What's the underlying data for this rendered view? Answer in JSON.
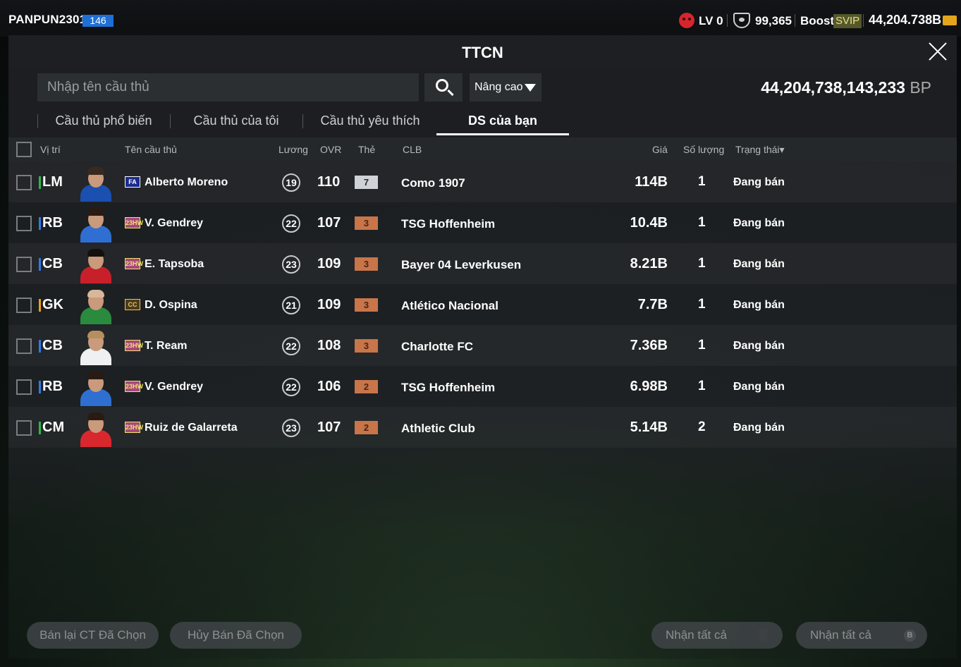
{
  "topbar": {
    "username": "PANPUN2301",
    "level": "146",
    "lv_text": "LV 0",
    "coins": "99,365",
    "boost": "Boost",
    "svip": "SVIP",
    "bp": "44,204.738B"
  },
  "panel": {
    "title": "TTCN",
    "search_placeholder": "Nhập tên cầu thủ",
    "advanced_label": "Nâng cao",
    "bp_total": "44,204,738,143,233",
    "bp_unit": "BP"
  },
  "tabs": [
    "Cầu thủ phổ biến",
    "Cầu thủ của tôi",
    "Cầu thủ yêu thích",
    "DS của bạn"
  ],
  "columns": {
    "position": "Vị trí",
    "name": "Tên cầu thủ",
    "wage": "Lương",
    "ovr": "OVR",
    "card": "Thẻ",
    "club": "CLB",
    "price": "Giá",
    "quantity": "Số lượng",
    "status": "Trạng thái▾"
  },
  "rows": [
    {
      "pos": "LM",
      "pos_color": "#2db84a",
      "season": "FA",
      "season_bg": "#1b2c8c",
      "season_fg": "#ffffff",
      "name": "Alberto Moreno",
      "wage": "19",
      "ovr": "110",
      "card": "7",
      "card_bg": "#cfd3d8",
      "card_fg": "#2b2e31",
      "club": "Como 1907",
      "price": "114B",
      "qty": "1",
      "status": "Đang bán",
      "kit": "#1b4fb0",
      "hair": "#3a2a1e"
    },
    {
      "pos": "RB",
      "pos_color": "#2f7be8",
      "season": "23HW",
      "season_bg": "#a8487e",
      "season_fg": "#f1e46a",
      "name": "V. Gendrey",
      "wage": "22",
      "ovr": "107",
      "card": "3",
      "card_bg": "#c8754a",
      "card_fg": "#4b2412",
      "club": "TSG Hoffenheim",
      "price": "10.4B",
      "qty": "1",
      "status": "Đang bán",
      "kit": "#2f6fd1",
      "hair": "#2a1b12"
    },
    {
      "pos": "CB",
      "pos_color": "#2f7be8",
      "season": "23HW",
      "season_bg": "#a8487e",
      "season_fg": "#f1e46a",
      "name": "E. Tapsoba",
      "wage": "23",
      "ovr": "109",
      "card": "3",
      "card_bg": "#c8754a",
      "card_fg": "#4b2412",
      "club": "Bayer 04 Leverkusen",
      "price": "8.21B",
      "qty": "1",
      "status": "Đang bán",
      "kit": "#c8202a",
      "hair": "#151010"
    },
    {
      "pos": "GK",
      "pos_color": "#e6a21e",
      "season": "CC",
      "season_bg": "#4a3b1a",
      "season_fg": "#f0c15a",
      "name": "D. Ospina",
      "wage": "21",
      "ovr": "109",
      "card": "3",
      "card_bg": "#c8754a",
      "card_fg": "#4b2412",
      "club": "Atlético Nacional",
      "price": "7.7B",
      "qty": "1",
      "status": "Đang bán",
      "kit": "#2a8a3e",
      "hair": "#d8b79a"
    },
    {
      "pos": "CB",
      "pos_color": "#2f7be8",
      "season": "23HW",
      "season_bg": "#a8487e",
      "season_fg": "#f1e46a",
      "name": "T. Ream",
      "wage": "22",
      "ovr": "108",
      "card": "3",
      "card_bg": "#c8754a",
      "card_fg": "#4b2412",
      "club": "Charlotte FC",
      "price": "7.36B",
      "qty": "1",
      "status": "Đang bán",
      "kit": "#eef0f2",
      "hair": "#b78f5e"
    },
    {
      "pos": "RB",
      "pos_color": "#2f7be8",
      "season": "23HW",
      "season_bg": "#a8487e",
      "season_fg": "#f1e46a",
      "name": "V. Gendrey",
      "wage": "22",
      "ovr": "106",
      "card": "2",
      "card_bg": "#c8754a",
      "card_fg": "#4b2412",
      "club": "TSG Hoffenheim",
      "price": "6.98B",
      "qty": "1",
      "status": "Đang bán",
      "kit": "#2f6fd1",
      "hair": "#2a1b12"
    },
    {
      "pos": "CM",
      "pos_color": "#2db84a",
      "season": "23HW",
      "season_bg": "#a8487e",
      "season_fg": "#f1e46a",
      "name": "Ruiz de Galarreta",
      "wage": "23",
      "ovr": "107",
      "card": "2",
      "card_bg": "#c8754a",
      "card_fg": "#4b2412",
      "club": "Athletic Club",
      "price": "5.14B",
      "qty": "2",
      "status": "Đang bán",
      "kit": "#d8282e",
      "hair": "#2a1b12"
    }
  ],
  "footer": {
    "resell_selected": "Bán lại CT Đã Chọn",
    "cancel_selected": "Hủy Bán Đã Chọn",
    "claim_all_1": "Nhận tất cả",
    "claim_all_2": "Nhận tất cả",
    "bp_glyph": "B"
  }
}
